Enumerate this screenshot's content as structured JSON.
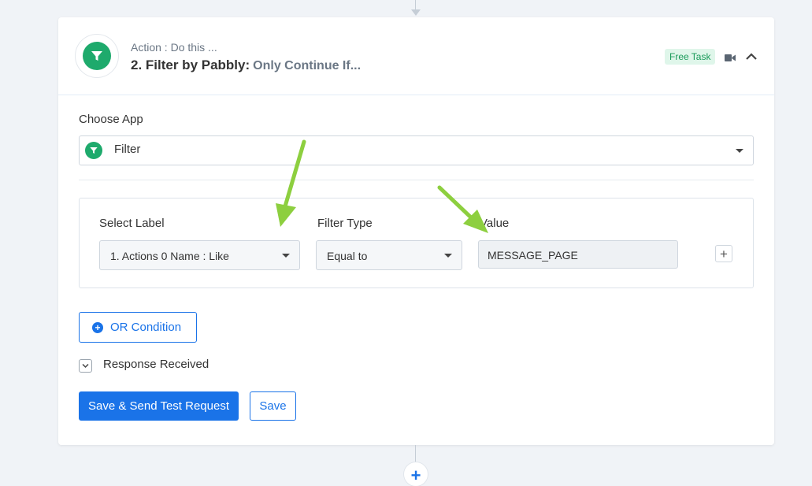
{
  "step": {
    "kicker": "Action : Do this ...",
    "title": "2. Filter by Pabbly:",
    "subtitle": "Only Continue If...",
    "badge": "Free Task",
    "icons": [
      "filter-icon",
      "video-icon",
      "chevron-up-icon"
    ]
  },
  "choose_app": {
    "label": "Choose App",
    "value": "Filter"
  },
  "filter": {
    "select_label": {
      "label": "Select Label",
      "value": "1. Actions 0 Name : Like"
    },
    "filter_type": {
      "label": "Filter Type",
      "value": "Equal to"
    },
    "value": {
      "label": "Value",
      "value": "MESSAGE_PAGE"
    },
    "add_row_symbol": "+"
  },
  "or_condition": {
    "label": "OR Condition",
    "icon": "plus-circle-icon"
  },
  "response": {
    "label": "Response Received",
    "icon": "chevron-down-icon"
  },
  "buttons": {
    "save_send": "Save & Send Test Request",
    "save": "Save"
  },
  "add_step_symbol": "+",
  "colors": {
    "accent": "#1a73e8",
    "filter_green": "#1eaa6c",
    "arrow_green": "#8dcf3f",
    "badge_text": "#1a9b5a",
    "badge_bg": "#dff6ea"
  }
}
